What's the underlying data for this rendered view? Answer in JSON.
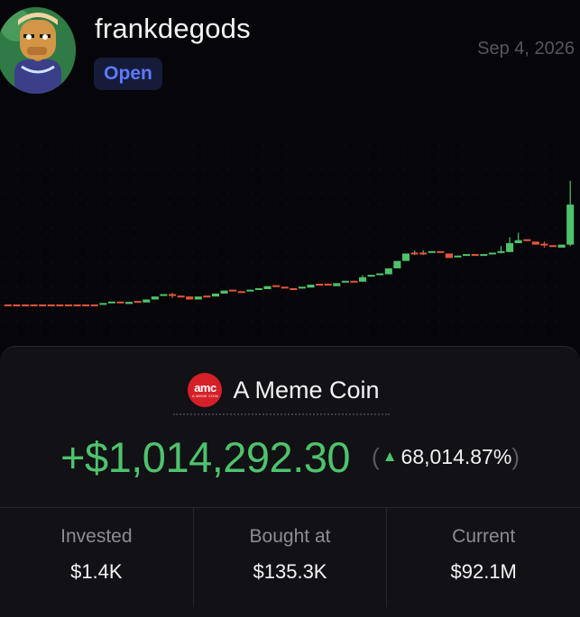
{
  "profile": {
    "username": "frankdegods",
    "status_badge": "Open",
    "date": "Sep 4, 2026"
  },
  "colors": {
    "up": "#4ec36b",
    "down": "#e8553a",
    "badge_text": "#5b7bff",
    "background": "#06060a"
  },
  "coin": {
    "logo_text": "amc",
    "logo_subtext": "A MEME COIN",
    "name": "A Meme Coin"
  },
  "pnl": {
    "amount": "+$1,014,292.30",
    "paren_open": "(",
    "arrow": "▲",
    "percent": "68,014.87%",
    "paren_close": ")"
  },
  "stats": [
    {
      "label": "Invested",
      "value": "$1.4K"
    },
    {
      "label": "Bought at",
      "value": "$135.3K"
    },
    {
      "label": "Current",
      "value": "$92.1M"
    }
  ],
  "chart_data": {
    "type": "candlestick",
    "grid": true,
    "candles": [
      {
        "o": 1.0,
        "c": 1.0
      },
      {
        "o": 1.0,
        "c": 1.0
      },
      {
        "o": 1.0,
        "c": 1.0
      },
      {
        "o": 1.0,
        "c": 1.0
      },
      {
        "o": 1.0,
        "c": 1.0
      },
      {
        "o": 1.0,
        "c": 1.0
      },
      {
        "o": 1.0,
        "c": 1.0
      },
      {
        "o": 1.0,
        "c": 1.0
      },
      {
        "o": 1.0,
        "c": 1.0
      },
      {
        "o": 1.0,
        "c": 1.0
      },
      {
        "o": 1.0,
        "c": 1.0
      },
      {
        "o": 1.0,
        "c": 1.05
      },
      {
        "o": 1.05,
        "c": 1.1
      },
      {
        "o": 1.1,
        "c": 1.05
      },
      {
        "o": 1.05,
        "c": 1.12
      },
      {
        "o": 1.12,
        "c": 1.1
      },
      {
        "o": 1.1,
        "c": 1.2
      },
      {
        "o": 1.2,
        "c": 1.3
      },
      {
        "o": 1.3,
        "c": 1.35
      },
      {
        "o": 1.35,
        "c": 1.3
      },
      {
        "o": 1.3,
        "c": 1.3
      },
      {
        "o": 1.3,
        "c": 1.2
      },
      {
        "o": 1.2,
        "c": 1.3
      },
      {
        "o": 1.3,
        "c": 1.3
      },
      {
        "o": 1.3,
        "c": 1.4
      },
      {
        "o": 1.4,
        "c": 1.5
      },
      {
        "o": 1.5,
        "c": 1.45
      },
      {
        "o": 1.45,
        "c": 1.45
      },
      {
        "o": 1.45,
        "c": 1.5
      },
      {
        "o": 1.5,
        "c": 1.55
      },
      {
        "o": 1.55,
        "c": 1.65
      },
      {
        "o": 1.65,
        "c": 1.6
      },
      {
        "o": 1.6,
        "c": 1.55
      },
      {
        "o": 1.55,
        "c": 1.55
      },
      {
        "o": 1.55,
        "c": 1.6
      },
      {
        "o": 1.6,
        "c": 1.7
      },
      {
        "o": 1.7,
        "c": 1.7
      },
      {
        "o": 1.7,
        "c": 1.65
      },
      {
        "o": 1.65,
        "c": 1.75
      },
      {
        "o": 1.75,
        "c": 1.8
      },
      {
        "o": 1.8,
        "c": 1.8
      },
      {
        "o": 1.8,
        "c": 1.95
      },
      {
        "o": 1.95,
        "c": 2.0
      },
      {
        "o": 2.0,
        "c": 2.05
      },
      {
        "o": 2.05,
        "c": 2.25
      },
      {
        "o": 2.25,
        "c": 2.5
      },
      {
        "o": 2.5,
        "c": 2.75
      },
      {
        "o": 2.75,
        "c": 2.75
      },
      {
        "o": 2.75,
        "c": 2.75
      },
      {
        "o": 2.75,
        "c": 2.8
      },
      {
        "o": 2.8,
        "c": 2.75
      },
      {
        "o": 2.75,
        "c": 2.6
      },
      {
        "o": 2.6,
        "c": 2.65
      },
      {
        "o": 2.65,
        "c": 2.7
      },
      {
        "o": 2.7,
        "c": 2.65
      },
      {
        "o": 2.65,
        "c": 2.7
      },
      {
        "o": 2.7,
        "c": 2.75
      },
      {
        "o": 2.75,
        "c": 2.8
      },
      {
        "o": 2.8,
        "c": 3.1
      },
      {
        "o": 3.1,
        "c": 3.2
      },
      {
        "o": 3.2,
        "c": 3.15
      },
      {
        "o": 3.15,
        "c": 3.05
      },
      {
        "o": 3.05,
        "c": 3.0
      },
      {
        "o": 3.0,
        "c": 2.95
      },
      {
        "o": 2.95,
        "c": 3.05
      },
      {
        "o": 3.05,
        "c": 4.4
      }
    ],
    "wicks": [
      {
        "i": 19,
        "h": 1.42,
        "l": 1.25
      },
      {
        "i": 41,
        "h": 2.02,
        "l": 1.9
      },
      {
        "i": 47,
        "h": 2.85,
        "l": 2.7
      },
      {
        "i": 48,
        "h": 2.85,
        "l": 2.7
      },
      {
        "i": 57,
        "h": 3.0,
        "l": 2.75
      },
      {
        "i": 58,
        "h": 3.3,
        "l": 2.8
      },
      {
        "i": 59,
        "h": 3.45,
        "l": 3.1
      },
      {
        "i": 62,
        "h": 3.15,
        "l": 2.95
      },
      {
        "i": 65,
        "h": 5.2,
        "l": 3.0
      }
    ],
    "ylim": [
      0,
      6.5
    ]
  }
}
